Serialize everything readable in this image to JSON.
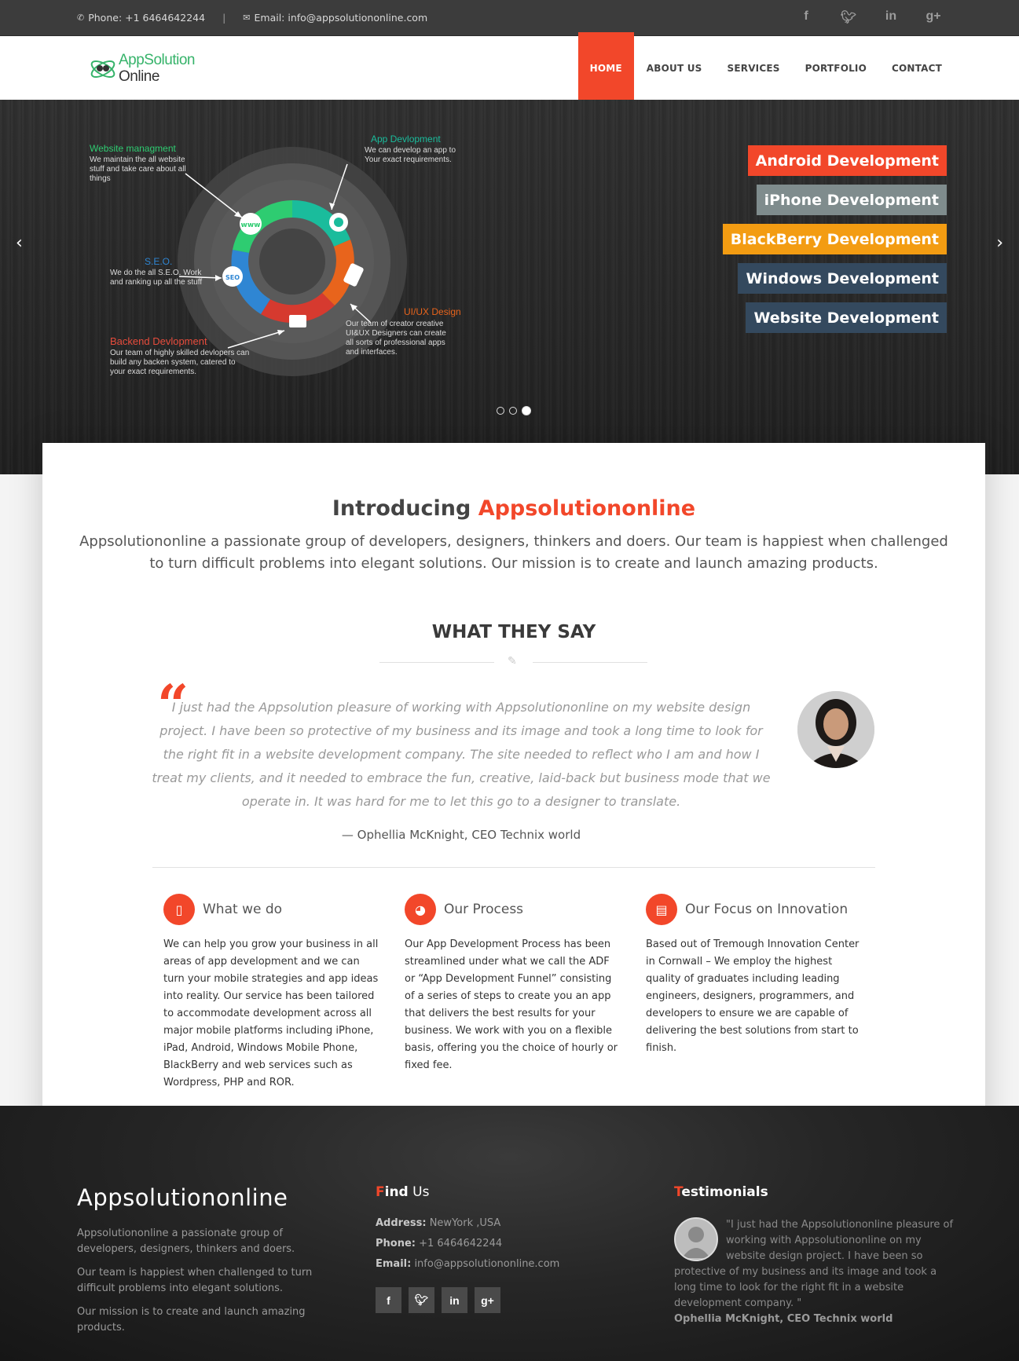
{
  "topbar": {
    "phone": "Phone: +1 6464642244",
    "email": "Email: info@appsolutiononline.com",
    "social": [
      "f",
      "t",
      "in",
      "g+"
    ]
  },
  "logo": {
    "line1": "AppSolution",
    "line2": "Online"
  },
  "nav": {
    "items": [
      {
        "label": "HOME",
        "active": true
      },
      {
        "label": "ABOUT US"
      },
      {
        "label": "SERVICES"
      },
      {
        "label": "PORTFOLIO"
      },
      {
        "label": "CONTACT"
      }
    ]
  },
  "hero": {
    "diagram": {
      "website": {
        "title": "Website managment",
        "desc": "We maintain the all website stuff and take care about all things"
      },
      "app": {
        "title": "App Devlopment",
        "desc": "We can develop an app to Your exact requirements."
      },
      "seo": {
        "title": "S.E.O.",
        "desc": "We do the all S.E.O. Work and ranking up all the stuff"
      },
      "uiux": {
        "title": "UI/UX Design",
        "desc": "Our team of creator creative UI&UX Designers can create all sorts of professional apps and interfaces."
      },
      "backend": {
        "title": "Backend Devlopment",
        "desc": "Our team of highly skilled devlopers can build any backen system, catered to your exact requirements."
      }
    },
    "tags": [
      {
        "label": "Android Development",
        "color": "#f2472a"
      },
      {
        "label": "iPhone Development",
        "color": "#7f8c8d"
      },
      {
        "label": "BlackBerry Development",
        "color": "#f39c12"
      },
      {
        "label": "Windows Development",
        "color": "#34495e"
      },
      {
        "label": "Website Development",
        "color": "#34495e"
      }
    ],
    "slides": 3,
    "active_slide": 3
  },
  "intro": {
    "title_main": "Introducing ",
    "title_accent": "Appsolutiononline",
    "text": "Appsolutiononline a passionate group of developers, designers, thinkers and doers. Our team is happiest when challenged to turn difficult problems into elegant solutions. Our mission is to create and launch amazing products."
  },
  "testimonial": {
    "heading": "WHAT THEY SAY",
    "quote": "I just had the Appsolution pleasure of working with Appsolutiononline on my website design project. I have been so protective of my business and its image and took a long time to look for the right fit in a website development company. The site needed to reflect who I am and how I treat my clients, and it needed to embrace the fun, creative, laid-back but business mode that we operate in. It was hard for me to let this go to a designer to translate.",
    "author": "— Ophellia McKnight, CEO Technix world"
  },
  "features": [
    {
      "title": "What we do",
      "icon": "mobile-icon",
      "text": "We can help you grow your business in all areas of app development and we can turn your mobile strategies and app ideas into reality. Our service has been tailored to accommodate development across all major mobile platforms including iPhone, iPad, Android, Windows Mobile Phone, BlackBerry and web services such as Wordpress, PHP and ROR."
    },
    {
      "title": "Our Process",
      "icon": "globe-icon",
      "text": "Our App Development Process has been streamlined under what we call the ADF or “App Development Funnel” consisting of a series of steps to create you an app that delivers the best results for your business. We work with you on a flexible basis, offering you the choice of hourly or fixed fee."
    },
    {
      "title": "Our Focus on Innovation",
      "icon": "tablet-icon",
      "text": "Based out of Tremough Innovation Center in Cornwall – We employ the highest quality of graduates including leading engineers, designers, programmers, and developers to ensure we are capable of delivering the best solutions from start to finish."
    }
  ],
  "footer": {
    "brand": "Appsolutiononline",
    "about": [
      "Appsolutiononline a passionate group of developers, designers, thinkers and doers.",
      "Our team is happiest when challenged to turn difficult problems into elegant solutions.",
      "Our mission is to create and launch amazing products."
    ],
    "find": {
      "h_first": "F",
      "h_rest": "ind",
      "h_light": " Us",
      "address_label": "Address:",
      "address": " NewYork ,USA",
      "phone_label": "Phone:",
      "phone": " +1 6464642244",
      "email_label": "Email:",
      "email": " info@appsolutiononline.com",
      "social": [
        "f",
        "t",
        "in",
        "g+"
      ]
    },
    "testimonials": {
      "h_first": "T",
      "h_rest": "estimonials",
      "text": "\"I just had the Appsolutiononline pleasure of working with Appsolutiononline on my website design project. I have been so protective of my business and its image and took a long time to look for the right fit in a website development company. \"",
      "who": "Ophellia McKnight, CEO Technix world"
    }
  },
  "colors": {
    "accent": "#f2472a",
    "dark": "#3c3c3c"
  }
}
